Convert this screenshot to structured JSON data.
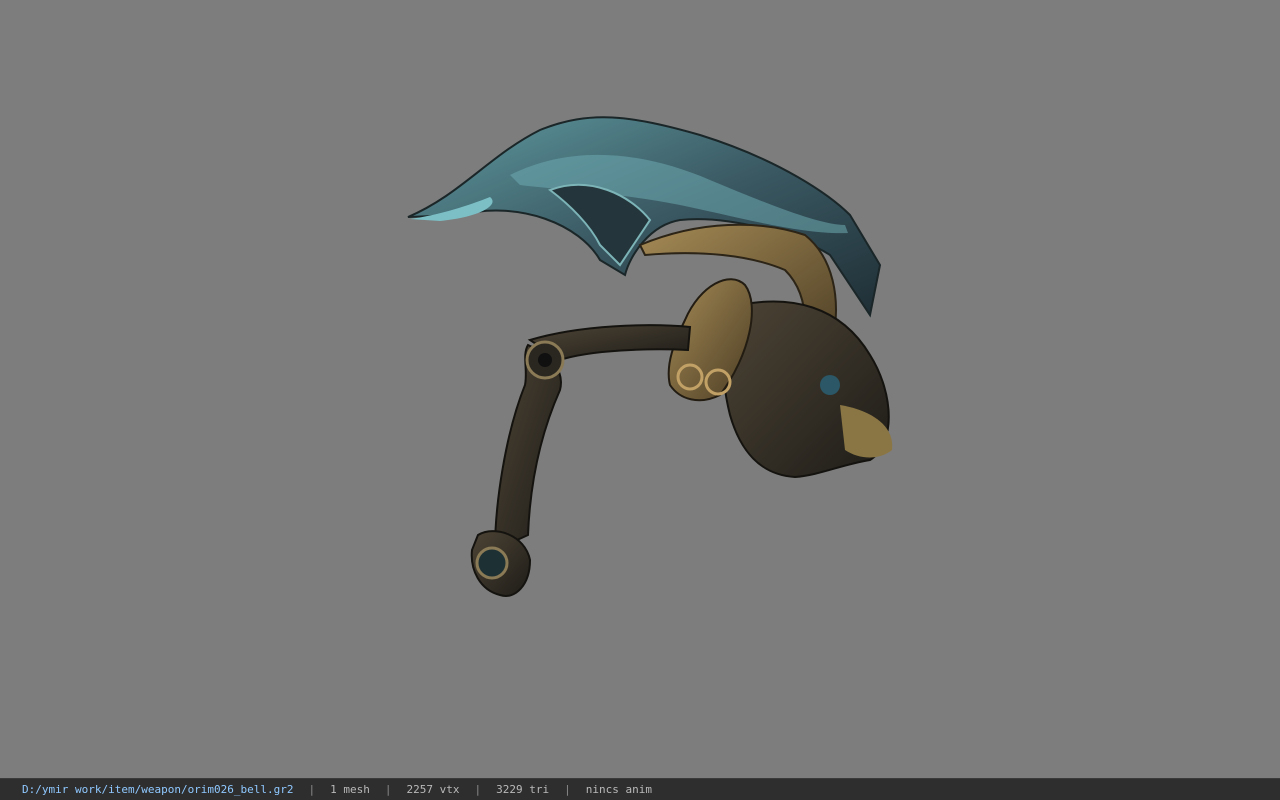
{
  "viewer": {
    "background_color": "#7d7d7d",
    "model_icon": "ram-horned-bell-weapon-model"
  },
  "statusbar": {
    "file_path": "D:/ymir work/item/weapon/orim026_bell.gr2",
    "separator": "|",
    "mesh_count": "1 mesh",
    "vertex_count": "2257 vtx",
    "triangle_count": "3229 tri",
    "anim_status": "nincs anim"
  }
}
